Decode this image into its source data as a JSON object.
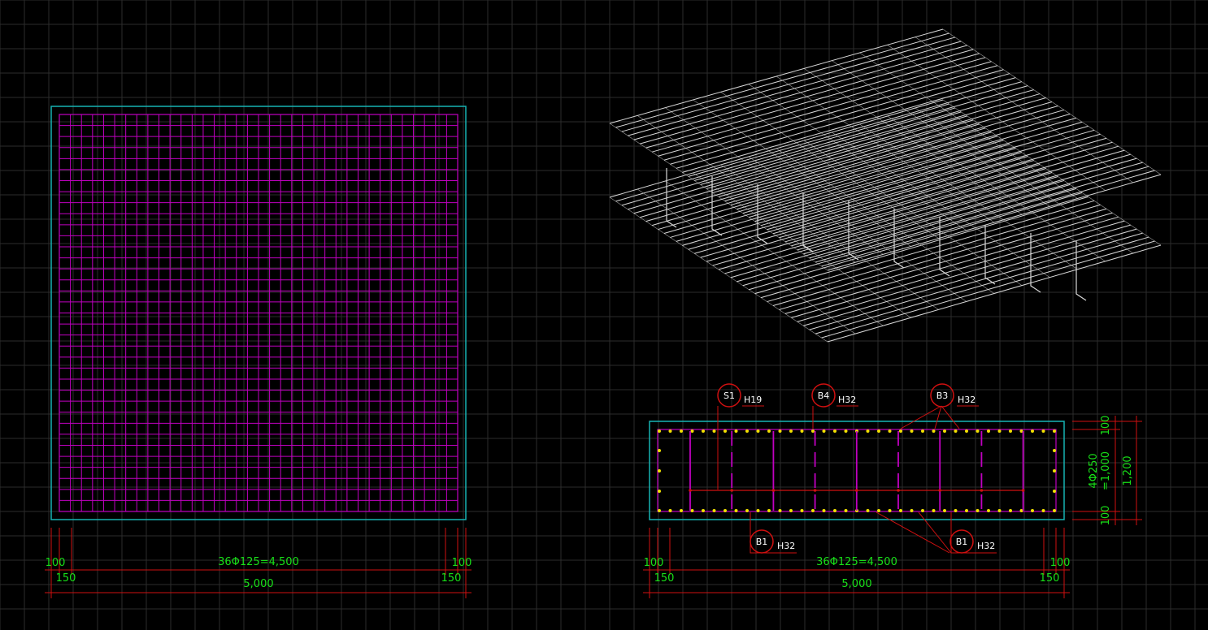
{
  "colors": {
    "background": "#000000",
    "grid": "#2c2c2c",
    "outline": "#17b3b3",
    "rebar_mesh": "#c000c0",
    "dimension_line": "#d01010",
    "dimension_text": "#18e018",
    "model_3d": "#d8d8d8",
    "bar_point": "#f0e000"
  },
  "plan_view": {
    "bars_each_direction": 37,
    "dimensions": {
      "left_edge": "100",
      "left_cover": "150",
      "middle": "36Φ125=4,500",
      "right_edge": "100",
      "right_cover": "150",
      "total": "5,000"
    }
  },
  "iso_view": {
    "bars_per_mat": 36,
    "description_icon": "rebar-cage-3d-icon"
  },
  "section_view": {
    "top_bar_count": 37,
    "bottom_bar_count": 37,
    "callouts": [
      {
        "mark": "S1",
        "size": "H19"
      },
      {
        "mark": "B4",
        "size": "H32"
      },
      {
        "mark": "B3",
        "size": "H32"
      },
      {
        "mark": "B1",
        "size": "H32"
      },
      {
        "mark": "B1",
        "size": "H32"
      }
    ],
    "dimensions": {
      "left_edge": "100",
      "left_cover": "150",
      "middle": "36Φ125=4,500",
      "right_edge": "100",
      "right_cover": "150",
      "total": "5,000",
      "side_top": "100",
      "side_middle_1": "4Φ250",
      "side_middle_2": "=1,000",
      "side_bottom": "100",
      "side_total": "1,200"
    }
  }
}
